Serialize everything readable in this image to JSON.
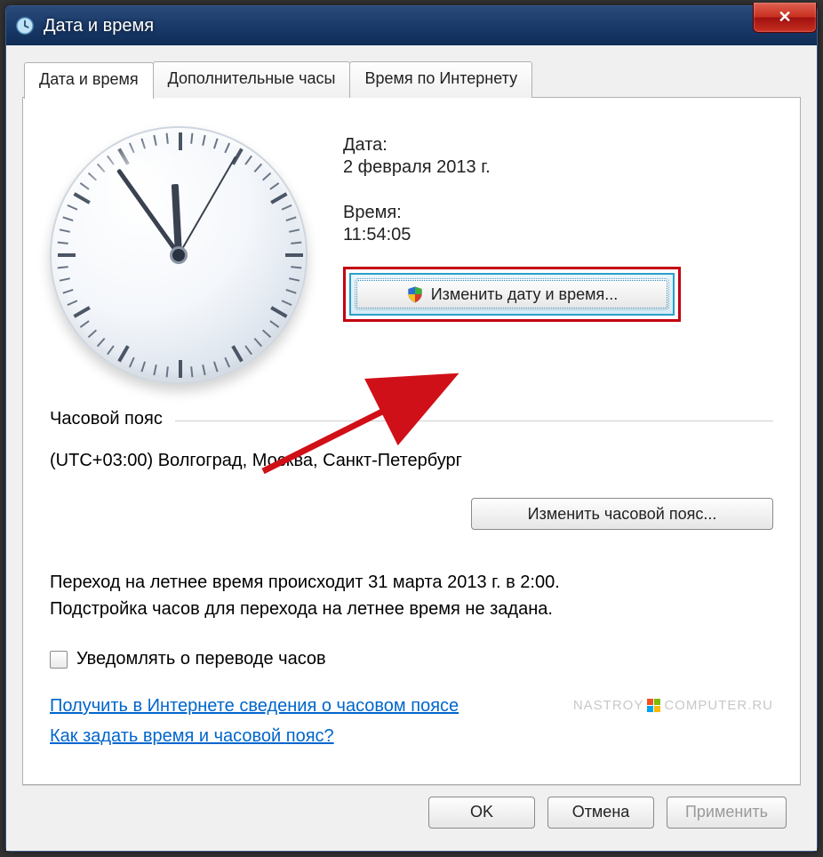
{
  "window": {
    "title": "Дата и время",
    "close_tooltip": "Закрыть"
  },
  "tabs": [
    {
      "label": "Дата и время",
      "active": true
    },
    {
      "label": "Дополнительные часы",
      "active": false
    },
    {
      "label": "Время по Интернету",
      "active": false
    }
  ],
  "main": {
    "date_label": "Дата:",
    "date_value": "2 февраля 2013 г.",
    "time_label": "Время:",
    "time_value": "11:54:05",
    "change_datetime_button": "Изменить дату и время...",
    "clock": {
      "hours": 11,
      "minutes": 54,
      "seconds": 5
    }
  },
  "timezone": {
    "header": "Часовой пояс",
    "value": "(UTC+03:00) Волгоград, Москва, Санкт-Петербург",
    "change_button": "Изменить часовой пояс..."
  },
  "dst": {
    "line1": "Переход на летнее время происходит 31 марта 2013 г. в 2:00.",
    "line2": "Подстройка часов для перехода на летнее время не задана.",
    "notify_label": "Уведомлять о переводе часов",
    "notify_checked": false
  },
  "links": {
    "tz_info": "Получить в Интернете сведения о часовом поясе",
    "how_to": "Как задать время и часовой пояс?"
  },
  "watermark": {
    "left": "NASTROY",
    "right": "COMPUTER.RU"
  },
  "footer": {
    "ok": "OK",
    "cancel": "Отмена",
    "apply": "Применить"
  },
  "annotation": {
    "highlight_color": "#c40010",
    "arrow_color": "#d01018"
  }
}
